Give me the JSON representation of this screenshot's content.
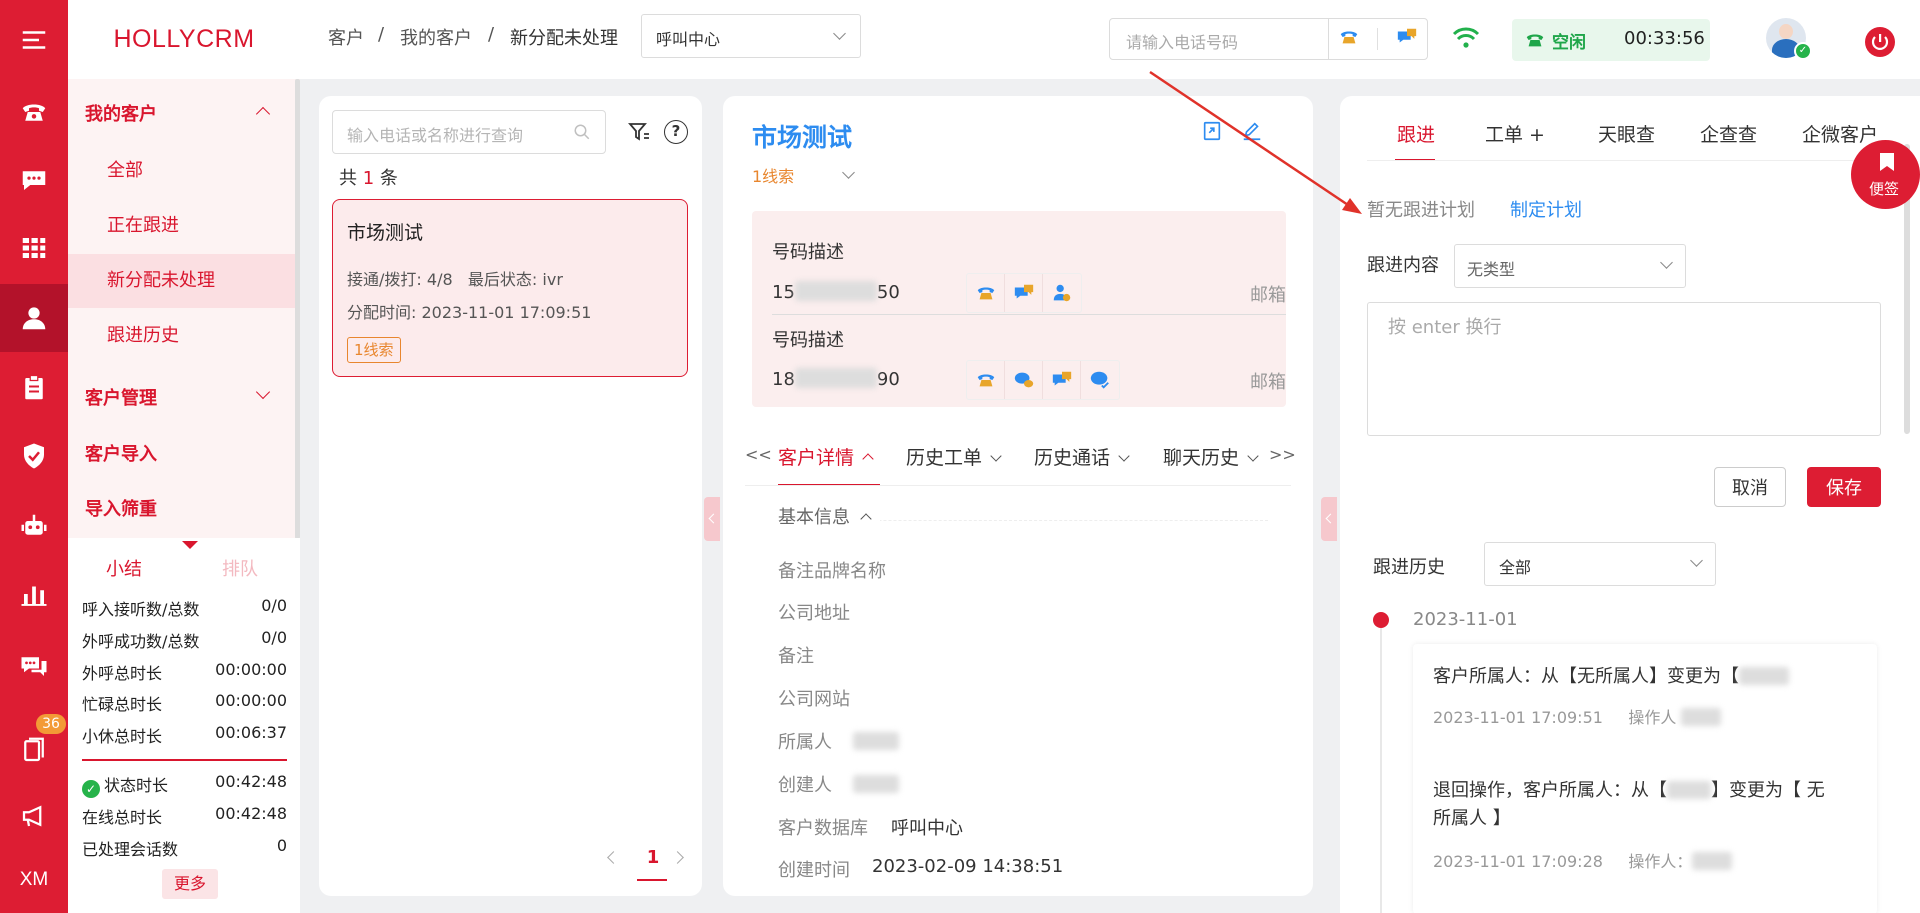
{
  "app": {
    "logo": "HOLLYCRM"
  },
  "rail": {
    "items": [
      "menu-icon",
      "phone-icon",
      "chat-icon",
      "grid-icon",
      "customer-icon",
      "clipboard-icon",
      "shield-icon",
      "robot-icon",
      "chart-icon",
      "message-icon",
      "book-icon",
      "megaphone-icon"
    ],
    "book_badge": "36",
    "bottom_label": "XM"
  },
  "menu": {
    "my_customers": "我的客户",
    "items": [
      "全部",
      "正在跟进",
      "新分配未处理",
      "跟进历史"
    ],
    "customer_management": "客户管理",
    "customer_import": "客户导入",
    "import_dedupe": "导入筛重",
    "summary_tab": "小结",
    "queue_tab": "排队",
    "stats": [
      {
        "label": "呼入接听数/总数",
        "value": "0/0"
      },
      {
        "label": "外呼成功数/总数",
        "value": "0/0"
      },
      {
        "label": "外呼总时长",
        "value": "00:00:00"
      },
      {
        "label": "忙碌总时长",
        "value": "00:00:00"
      },
      {
        "label": "小休总时长",
        "value": "00:06:37"
      }
    ],
    "stats2": [
      {
        "label": "状态时长",
        "value": "00:42:48"
      },
      {
        "label": "在线总时长",
        "value": "00:42:48"
      },
      {
        "label": "已处理会话数",
        "value": "0"
      }
    ],
    "more": "更多"
  },
  "topbar": {
    "breadcrumb": [
      "客户",
      "我的客户",
      "新分配未处理"
    ],
    "sep": "/",
    "call_center": "呼叫中心",
    "phone_placeholder": "请输入电话号码",
    "status": "空闲",
    "timer": "00:33:56"
  },
  "list": {
    "search_placeholder": "输入电话或名称进行查询",
    "total_prefix": "共",
    "total": "1",
    "total_suffix": "条",
    "card": {
      "name": "市场测试",
      "connect_label": "接通/拨打:",
      "connect_value": "4/8",
      "status_label": "最后状态:",
      "status_value": "ivr",
      "assign_label": "分配时间:",
      "assign_value": "2023-11-01 17:09:51",
      "tag": "1线索"
    },
    "page": "1"
  },
  "detail": {
    "title": "市场测试",
    "clue": "1线索",
    "phones": [
      {
        "desc": "号码描述",
        "prefix": "15",
        "suffix": "50",
        "email": "邮箱"
      },
      {
        "desc": "号码描述",
        "prefix": "18",
        "suffix": "90",
        "email": "邮箱"
      }
    ],
    "tabs": [
      "客户详情",
      "历史工单",
      "历史通话",
      "聊天历史"
    ],
    "prev": "<<",
    "next": ">>",
    "basic_info": "基本信息",
    "fields": [
      {
        "label": "备注品牌名称",
        "value": ""
      },
      {
        "label": "公司地址",
        "value": ""
      },
      {
        "label": "备注",
        "value": ""
      },
      {
        "label": "公司网站",
        "value": ""
      },
      {
        "label": "所属人",
        "value": ""
      },
      {
        "label": "创建人",
        "value": ""
      },
      {
        "label": "客户数据库",
        "value": "呼叫中心"
      },
      {
        "label": "创建时间",
        "value": "2023-02-09 14:38:51"
      }
    ]
  },
  "followup": {
    "tabs": [
      "跟进",
      "工单 +",
      "天眼查",
      "企查查",
      "企微客户"
    ],
    "no_plan": "暂无跟进计划",
    "make_plan": "制定计划",
    "content_label": "跟进内容",
    "type_value": "无类型",
    "textarea_placeholder": "按 enter 换行",
    "cancel": "取消",
    "save": "保存",
    "history_label": "跟进历史",
    "history_filter": "全部",
    "date": "2023-11-01",
    "entries": [
      {
        "text": "客户所属人：从【无所属人】变更为【",
        "time": "2023-11-01 17:09:51",
        "operator": "操作人"
      },
      {
        "text": "退回操作，客户所属人：从【",
        "text2": "】变更为【 无",
        "text3": "所属人 】",
        "time": "2023-11-01 17:09:28",
        "operator": "操作人："
      }
    ],
    "bookmark": "便签"
  },
  "colors": {
    "brand": "#dd1d33",
    "link": "#2d8cf0",
    "orange": "#e8862e"
  }
}
